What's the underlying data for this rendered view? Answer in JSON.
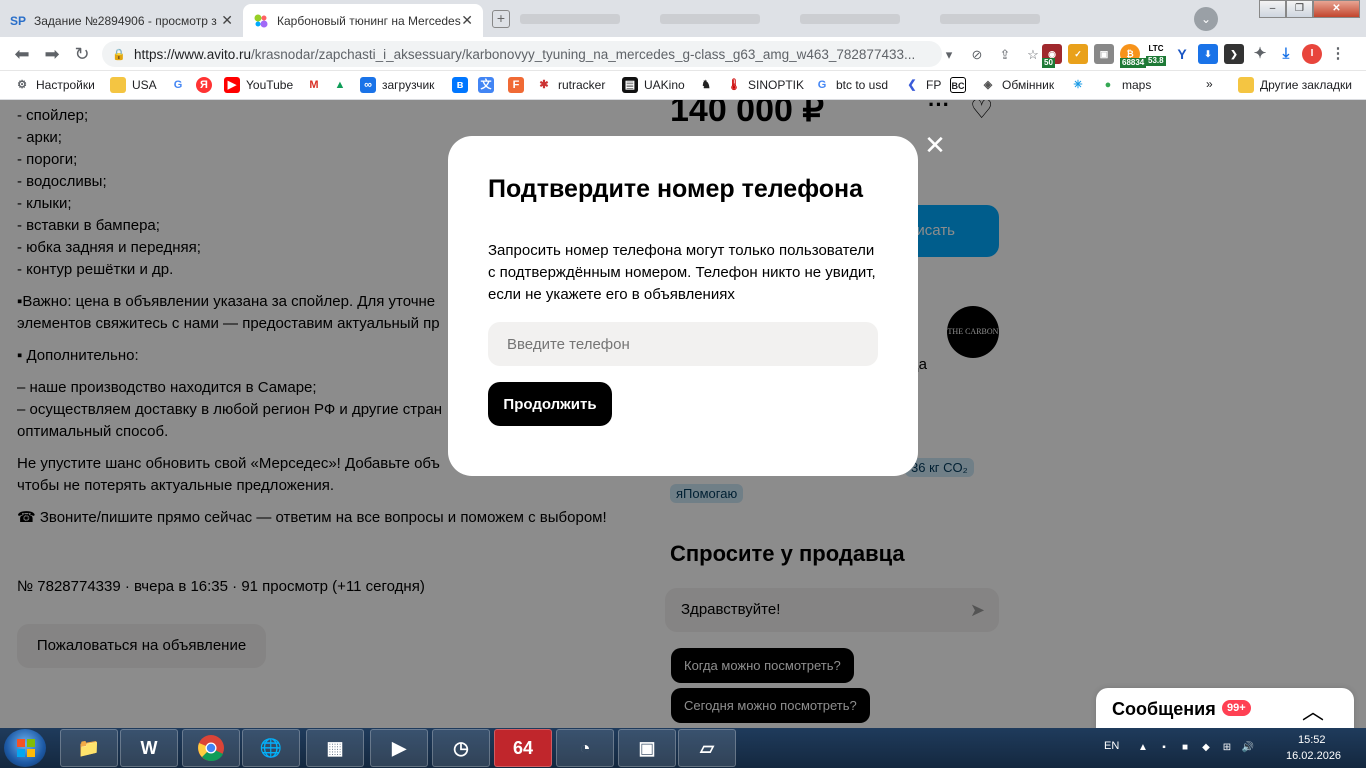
{
  "browser": {
    "tabs": [
      {
        "title": "Задание №2894906 - просмотр з",
        "icon": "SP"
      },
      {
        "title": "Карбоновый тюнинг на Mercedes"
      }
    ],
    "url_host": "https://www.avito.ru",
    "url_path": "/krasnodar/zapchasti_i_aksessuary/karbonovyy_tyuning_na_mercedes_g-class_g63_amg_w463_782877433...",
    "extensions": {
      "ext1_badge": "50",
      "btc_badge": "68834",
      "ltc_label": "LTC",
      "ltc_badge": "53.8"
    },
    "bookmarks": [
      "Настройки",
      "USA",
      "YouTube",
      "загрузчик",
      "rutracker",
      "UAKino",
      "SINOPTIK",
      "btc to usd",
      "FP",
      "Обмінник",
      "maps",
      "Другие закладки"
    ],
    "bookmark_more": "»"
  },
  "page": {
    "description_lines": [
      "- спойлер;",
      "- арки;",
      "- пороги;",
      "- водосливы;",
      "- клыки;",
      "- вставки в бампера;",
      "- юбка задняя и передняя;",
      "- контур решётки и др."
    ],
    "important_line1": "▪Важно: цена в объявлении указана за спойлер. Для уточне",
    "important_line2": "элементов свяжитесь с нами — предоставим актуальный пр",
    "additional_heading": "▪ Дополнительно:",
    "additional_line1": "– наше производство находится в Самаре;",
    "additional_line2": "– осуществляем доставку в любой регион РФ и другие стран",
    "additional_line3": "оптимальный способ.",
    "cta_line1": "Не упустите шанс обновить свой «Мерседес»! Добавьте объ",
    "cta_line2": "чтобы не потерять актуальные предложения.",
    "call_line": "☎ Звоните/пишите прямо сейчас — ответим на все вопросы и поможем с выбором!",
    "meta": "№ 7828774339 · вчера в 16:35 · 91 просмотр (+11 сегодня)",
    "report_button": "Пожаловаться на объявление",
    "price": "140 000 ₽",
    "write_button": "исать",
    "seller_logo": "THE CARBON",
    "seller_fragment": "ца",
    "tag_co2": "36 кг CO₂",
    "tag_help": "яПомогаю",
    "ask_title": "Спросите у продавца",
    "ask_input_value": "Здравствуйте!",
    "chip1": "Когда можно посмотреть?",
    "chip2": "Сегодня можно посмотреть?",
    "messages_label": "Сообщения",
    "messages_badge": "99+"
  },
  "modal": {
    "title": "Подтвердите номер телефона",
    "text": "Запросить номер телефона могут только пользователи с подтверждённым номером. Телефон никто не увидит, если не укажете его в объявлениях",
    "input_placeholder": "Введите телефон",
    "continue_button": "Продолжить"
  },
  "taskbar": {
    "lang": "EN",
    "time": "15:52",
    "date": "16.02.2026",
    "app_64": "64"
  },
  "colors": {
    "accent": "#00aaff",
    "badge": "#ff4053"
  }
}
